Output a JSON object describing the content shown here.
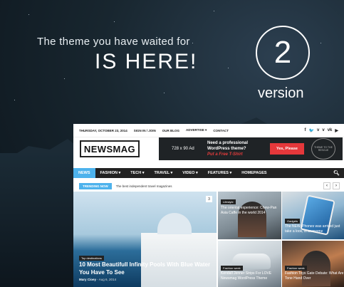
{
  "hero": {
    "tagline": "The theme you have waited for",
    "headline": "IS HERE!",
    "version_number": "2",
    "version_label": "version"
  },
  "site": {
    "topbar": {
      "date": "THURSDAY, OCTOBER 23, 2014",
      "links": [
        "SIGN IN / JOIN",
        "OUR BLOG",
        "ADVERTISE ▾",
        "CONTACT"
      ],
      "social": [
        "f",
        "🐦",
        "v",
        "v",
        "vk",
        "▶"
      ]
    },
    "logo": "NEWSMAG",
    "ad": {
      "size": "728 x 90 Ad",
      "line1": "Need a professional",
      "line2": "WordPress theme?",
      "line3": "Put a Free T-Shirt",
      "button": "Yes, Please",
      "badge": "THEME TO THE RESCUE"
    },
    "nav": [
      "NEWS",
      "FASHION ▾",
      "TECH ▾",
      "TRAVEL ▾",
      "VIDEO ▾",
      "FEATURES ▾",
      "HOMEPAGES"
    ],
    "trending": {
      "badge": "TRENDING NOW",
      "text": "The best independent travel magazines"
    },
    "feature": {
      "tag": "Top destinations",
      "title": "10 Most Beautifull Infinity Pools With Blue Water You Have To See",
      "author": "Mary Cioey",
      "date": "Aug 6, 2014",
      "count": "3"
    },
    "tiles": [
      {
        "tag": "Lifestyle",
        "caption": "The oriental experience: Chew-Pan Asia Caffe in the world 2014"
      },
      {
        "tag": "Gadgets",
        "caption": "The NEW iPhones was arrived just take a look, is awesome"
      },
      {
        "tag": "Fashion week",
        "caption": "Kendall Jenner Strips For LOVE Newsmag WordPress Theme"
      },
      {
        "tag": "Fashion week",
        "caption": "Fashion Toys Gate Debate: What Are Tone Hand Over"
      }
    ]
  }
}
